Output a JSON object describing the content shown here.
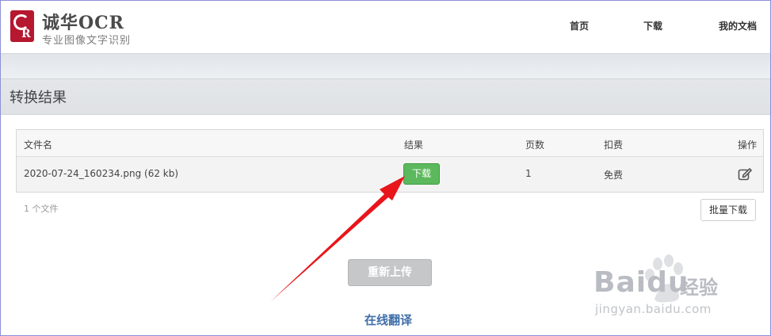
{
  "header": {
    "brand_title": "诚华OCR",
    "brand_subtitle": "专业图像文字识别",
    "logo_letter": "R",
    "nav": [
      {
        "label": "首页"
      },
      {
        "label": "下载"
      },
      {
        "label": "我的文档"
      }
    ]
  },
  "page": {
    "title": "转换结果"
  },
  "table": {
    "headers": {
      "filename": "文件名",
      "result": "结果",
      "pages": "页数",
      "fee": "扣费",
      "action": "操作"
    },
    "rows": [
      {
        "filename": "2020-07-24_160234.png (62 kb)",
        "result_button": "下载",
        "pages": "1",
        "fee": "免费",
        "action_icon": "edit-icon"
      }
    ]
  },
  "footer": {
    "file_count": "1 个文件",
    "batch_download": "批量下载",
    "reupload": "重新上传",
    "translate_link": "在线翻译"
  },
  "watermark": {
    "brand": "Baidu",
    "suffix": "经验",
    "url": "jingyan.baidu.com"
  },
  "colors": {
    "brand_red": "#b5182f",
    "download_green": "#5cb85c",
    "link_blue": "#3f6ea8",
    "arrow_red": "#e8151b"
  }
}
